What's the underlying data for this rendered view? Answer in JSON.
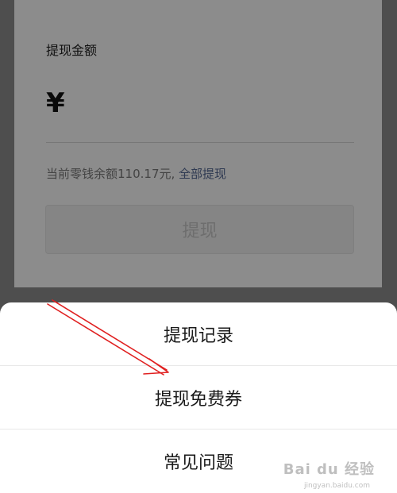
{
  "withdraw": {
    "title": "提现金额",
    "currency_symbol": "¥",
    "balance_text": "当前零钱余额110.17元,",
    "withdraw_all_label": "全部提现",
    "button_label": "提现"
  },
  "action_sheet": {
    "items": [
      {
        "label": "提现记录"
      },
      {
        "label": "提现免费券"
      },
      {
        "label": "常见问题"
      }
    ]
  },
  "annotation": {
    "color": "#e02020",
    "target": "提现免费券"
  },
  "watermark": {
    "text": "Bai du 经验",
    "sub": "jingyan.baidu.com"
  },
  "colors": {
    "link": "#576b95",
    "overlay": "rgba(0,0,0,0.45)"
  }
}
